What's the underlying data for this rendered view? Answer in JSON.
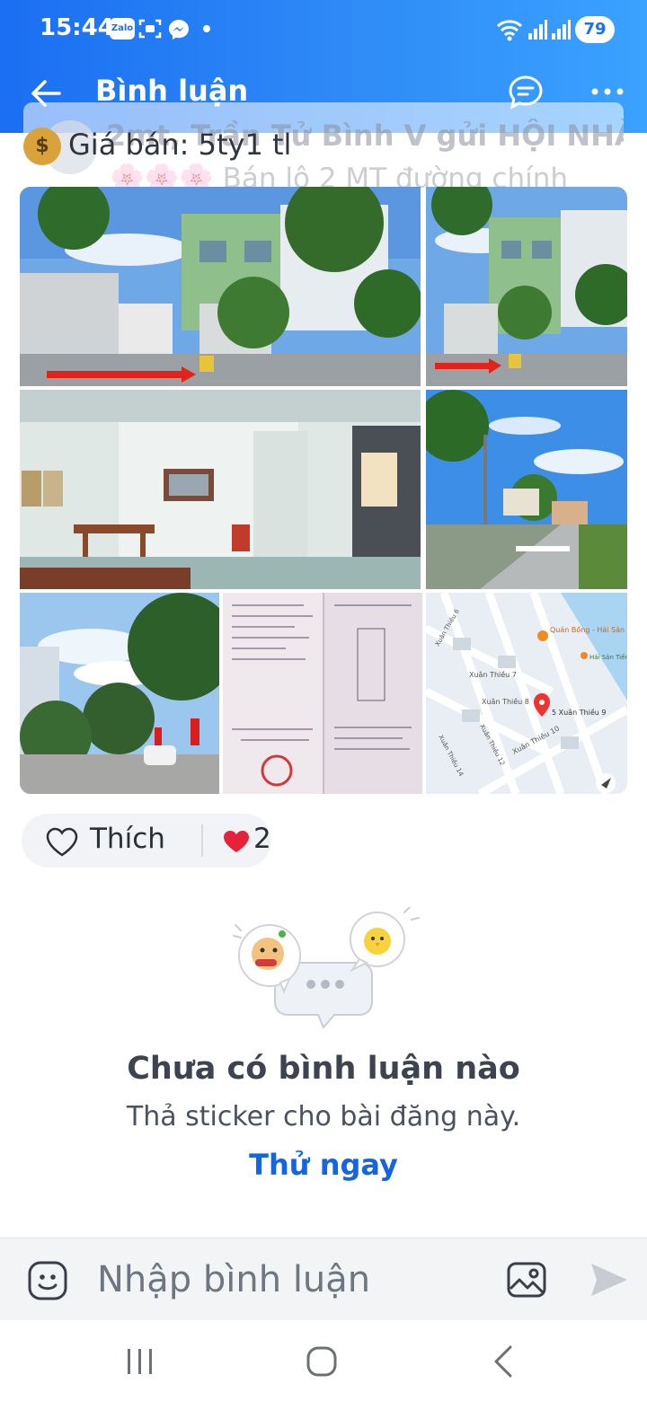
{
  "status_bar": {
    "time": "15:44",
    "app_icons": [
      "zalo-icon",
      "scan-icon",
      "messenger-icon"
    ],
    "zalo_badge_text": "Zalo",
    "battery": "79"
  },
  "app_bar": {
    "title": "Bình luận"
  },
  "post_preview": {
    "title": "2mt, Trần Tử Bình V gửi HỘI NHÀ...",
    "subtitle": "🌸🌸🌸 Bán lô 2 MT đường chính",
    "price_text": "Giá bán: 5ty1 tl"
  },
  "photos": [
    {
      "subject": "house-front-with-red-arrow"
    },
    {
      "subject": "house-front-with-red-arrow"
    },
    {
      "subject": "house-interior"
    },
    {
      "subject": "street-view"
    },
    {
      "subject": "street-with-trees"
    },
    {
      "subject": "land-certificate-document"
    },
    {
      "subject": "map"
    }
  ],
  "map": {
    "labels": [
      "Quán Bống - Hải Sản Tươi Sống",
      "Hải Sản Tiến Cong",
      "Xuân Thiều 7",
      "Xuân Thiều 6",
      "Xuân Thiều 8",
      "5 Xuân Thiều 9",
      "Xuân Thiều 10",
      "Xuân Thiều 12",
      "Xuân Thiều 14"
    ]
  },
  "reactions": {
    "like_label": "Thích",
    "heart_count": "2"
  },
  "empty_state": {
    "title": "Chưa có bình luận nào",
    "subtitle": "Thả sticker cho bài đăng này.",
    "action_label": "Thử ngay"
  },
  "comment_bar": {
    "placeholder": "Nhập bình luận"
  },
  "colors": {
    "header_gradient_start": "#1a6ff2",
    "header_gradient_end": "#3aa2ff",
    "link_blue": "#1565e0",
    "heart_red": "#e8213a"
  }
}
